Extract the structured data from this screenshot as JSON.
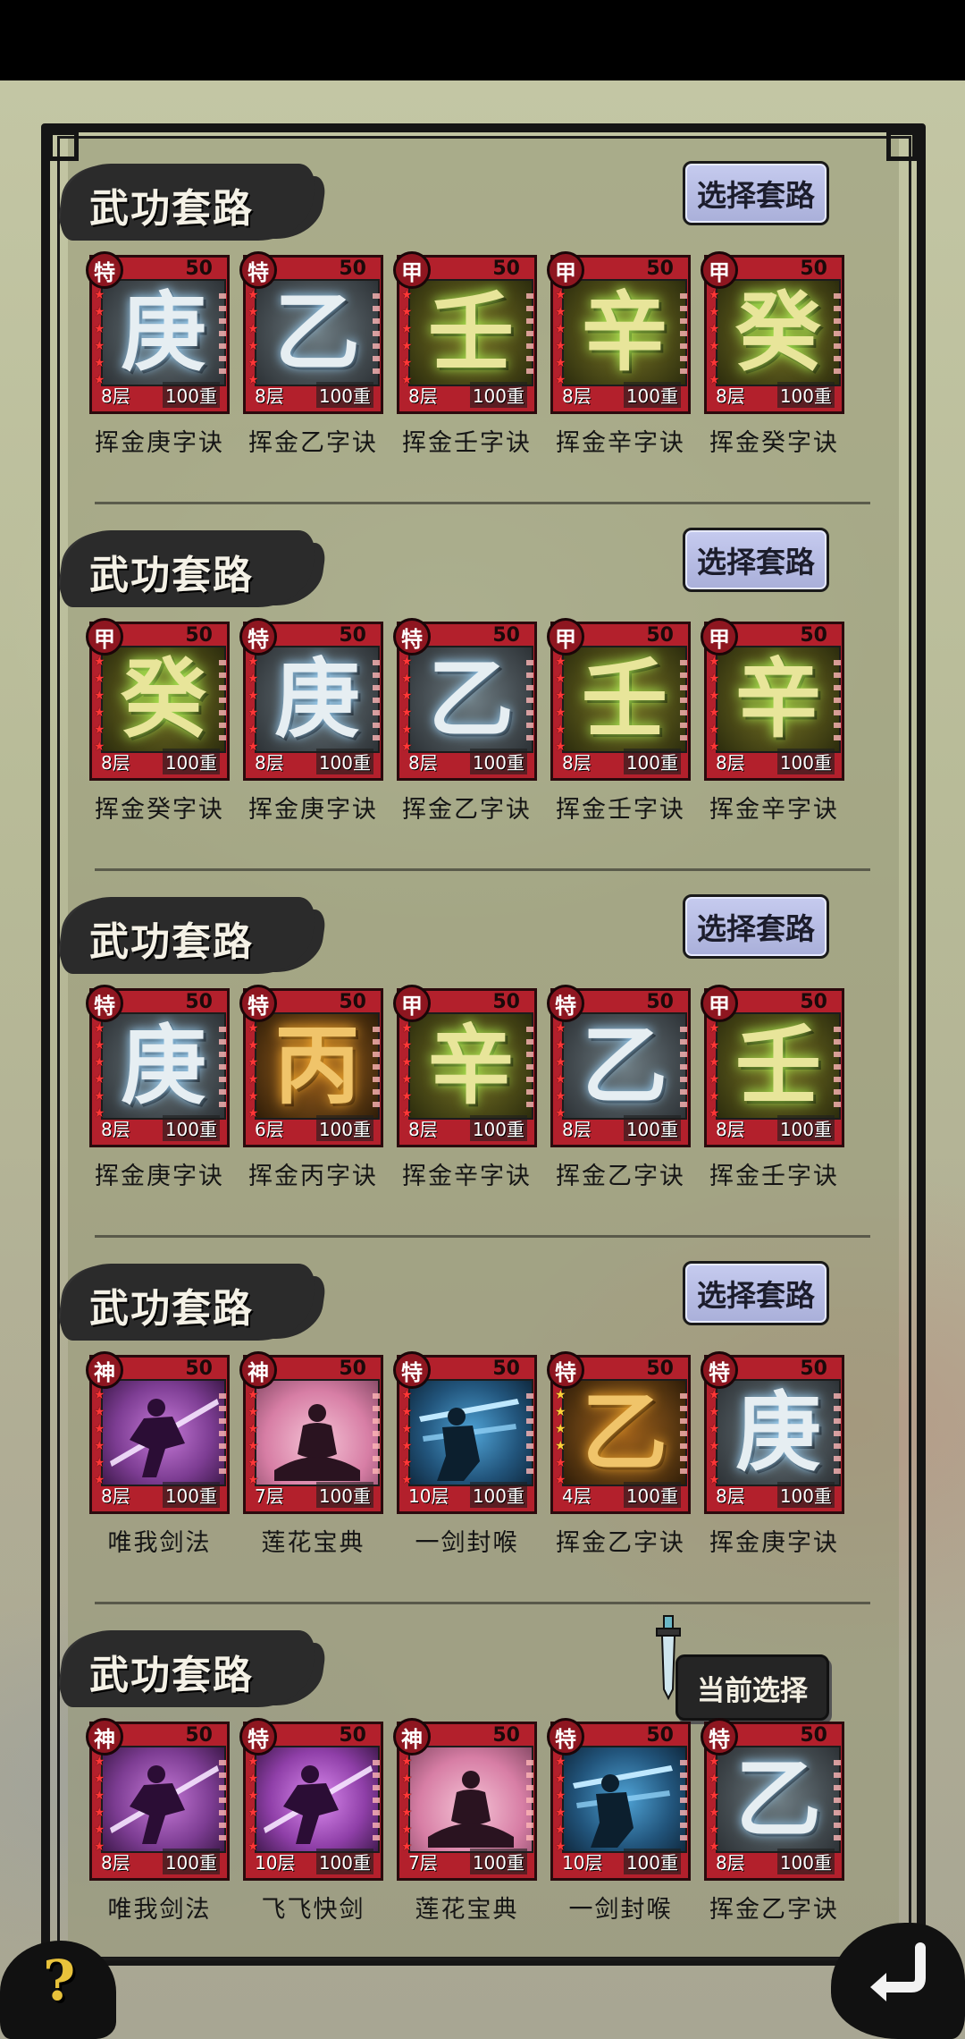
{
  "section_title": "武功套路",
  "select_label": "选择套路",
  "current_label": "当前选择",
  "sections": [
    {
      "button": "选择套路",
      "cards": [
        {
          "rank": "特",
          "cost": "50",
          "glyph": "庚",
          "level": "8层",
          "weight": "100重",
          "name": "挥金庚字诀",
          "theme": "gray",
          "glyph_color": "silver"
        },
        {
          "rank": "特",
          "cost": "50",
          "glyph": "乙",
          "level": "8层",
          "weight": "100重",
          "name": "挥金乙字诀",
          "theme": "gray",
          "glyph_color": "silver"
        },
        {
          "rank": "甲",
          "cost": "50",
          "glyph": "壬",
          "level": "8层",
          "weight": "100重",
          "name": "挥金壬字诀",
          "theme": "olive",
          "glyph_color": "gold"
        },
        {
          "rank": "甲",
          "cost": "50",
          "glyph": "辛",
          "level": "8层",
          "weight": "100重",
          "name": "挥金辛字诀",
          "theme": "olive",
          "glyph_color": "gold"
        },
        {
          "rank": "甲",
          "cost": "50",
          "glyph": "癸",
          "level": "8层",
          "weight": "100重",
          "name": "挥金癸字诀",
          "theme": "olive",
          "glyph_color": "gold"
        }
      ]
    },
    {
      "button": "选择套路",
      "cards": [
        {
          "rank": "甲",
          "cost": "50",
          "glyph": "癸",
          "level": "8层",
          "weight": "100重",
          "name": "挥金癸字诀",
          "theme": "olive",
          "glyph_color": "gold"
        },
        {
          "rank": "特",
          "cost": "50",
          "glyph": "庚",
          "level": "8层",
          "weight": "100重",
          "name": "挥金庚字诀",
          "theme": "gray",
          "glyph_color": "silver"
        },
        {
          "rank": "特",
          "cost": "50",
          "glyph": "乙",
          "level": "8层",
          "weight": "100重",
          "name": "挥金乙字诀",
          "theme": "gray",
          "glyph_color": "silver"
        },
        {
          "rank": "甲",
          "cost": "50",
          "glyph": "壬",
          "level": "8层",
          "weight": "100重",
          "name": "挥金壬字诀",
          "theme": "olive",
          "glyph_color": "gold"
        },
        {
          "rank": "甲",
          "cost": "50",
          "glyph": "辛",
          "level": "8层",
          "weight": "100重",
          "name": "挥金辛字诀",
          "theme": "olive",
          "glyph_color": "gold"
        }
      ]
    },
    {
      "button": "选择套路",
      "cards": [
        {
          "rank": "特",
          "cost": "50",
          "glyph": "庚",
          "level": "8层",
          "weight": "100重",
          "name": "挥金庚字诀",
          "theme": "gray",
          "glyph_color": "silver"
        },
        {
          "rank": "特",
          "cost": "50",
          "glyph": "丙",
          "level": "6层",
          "weight": "100重",
          "name": "挥金丙字诀",
          "theme": "amber",
          "glyph_color": "amber"
        },
        {
          "rank": "甲",
          "cost": "50",
          "glyph": "辛",
          "level": "8层",
          "weight": "100重",
          "name": "挥金辛字诀",
          "theme": "olive",
          "glyph_color": "gold"
        },
        {
          "rank": "特",
          "cost": "50",
          "glyph": "乙",
          "level": "8层",
          "weight": "100重",
          "name": "挥金乙字诀",
          "theme": "gray",
          "glyph_color": "silver"
        },
        {
          "rank": "甲",
          "cost": "50",
          "glyph": "壬",
          "level": "8层",
          "weight": "100重",
          "name": "挥金壬字诀",
          "theme": "olive",
          "glyph_color": "gold"
        }
      ]
    },
    {
      "button": "选择套路",
      "cards": [
        {
          "rank": "神",
          "cost": "50",
          "glyph": "",
          "level": "8层",
          "weight": "100重",
          "name": "唯我剑法",
          "theme": "purple",
          "glyph_color": "silver"
        },
        {
          "rank": "神",
          "cost": "50",
          "glyph": "",
          "level": "7层",
          "weight": "100重",
          "name": "莲花宝典",
          "theme": "pink",
          "glyph_color": "silver"
        },
        {
          "rank": "特",
          "cost": "50",
          "glyph": "",
          "level": "10层",
          "weight": "100重",
          "name": "一剑封喉",
          "theme": "blue",
          "glyph_color": "silver"
        },
        {
          "rank": "特",
          "cost": "50",
          "glyph": "乙",
          "level": "4层",
          "weight": "100重",
          "name": "挥金乙字诀",
          "theme": "amber",
          "glyph_color": "amber",
          "gold_stars": true
        },
        {
          "rank": "特",
          "cost": "50",
          "glyph": "庚",
          "level": "8层",
          "weight": "100重",
          "name": "挥金庚字诀",
          "theme": "gray",
          "glyph_color": "silver"
        }
      ]
    },
    {
      "button": "当前选择",
      "current": true,
      "cards": [
        {
          "rank": "神",
          "cost": "50",
          "glyph": "",
          "level": "8层",
          "weight": "100重",
          "name": "唯我剑法",
          "theme": "purple",
          "glyph_color": "silver"
        },
        {
          "rank": "特",
          "cost": "50",
          "glyph": "",
          "level": "10层",
          "weight": "100重",
          "name": "飞飞快剑",
          "theme": "violet",
          "glyph_color": "silver"
        },
        {
          "rank": "神",
          "cost": "50",
          "glyph": "",
          "level": "7层",
          "weight": "100重",
          "name": "莲花宝典",
          "theme": "pink",
          "glyph_color": "silver"
        },
        {
          "rank": "特",
          "cost": "50",
          "glyph": "",
          "level": "10层",
          "weight": "100重",
          "name": "一剑封喉",
          "theme": "blue",
          "glyph_color": "silver"
        },
        {
          "rank": "特",
          "cost": "50",
          "glyph": "乙",
          "level": "8层",
          "weight": "100重",
          "name": "挥金乙字诀",
          "theme": "gray",
          "glyph_color": "silver"
        }
      ]
    }
  ],
  "help_label": "?",
  "icons": {
    "help": "question-mark-icon",
    "back": "return-arrow-icon",
    "pointer": "sword-pointer-icon"
  },
  "colors": {
    "card_red": "#b3202c",
    "button_lavender": "#c6cbef",
    "ink": "#2b2b2b"
  }
}
